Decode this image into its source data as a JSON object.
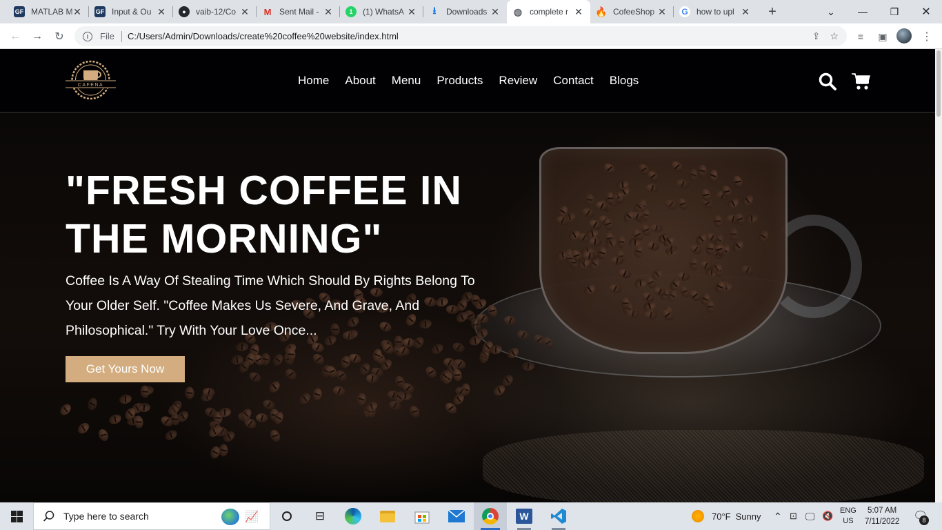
{
  "browser": {
    "tabs": [
      {
        "title": "MATLAB M",
        "favicon": "gfg"
      },
      {
        "title": "Input & Ou",
        "favicon": "gfg"
      },
      {
        "title": "vaib-12/Co",
        "favicon": "github"
      },
      {
        "title": "Sent Mail -",
        "favicon": "gmail"
      },
      {
        "title": "(1) WhatsA",
        "favicon": "whatsapp"
      },
      {
        "title": "Downloads",
        "favicon": "download"
      },
      {
        "title": "complete r",
        "favicon": "globe"
      },
      {
        "title": "CofeeShop",
        "favicon": "firebase"
      },
      {
        "title": "how to upl",
        "favicon": "google"
      }
    ],
    "active_tab": 6,
    "address": {
      "scheme": "File",
      "url": "C:/Users/Admin/Downloads/create%20coffee%20website/index.html"
    }
  },
  "site": {
    "logo_text": "CAFENA",
    "nav": [
      "Home",
      "About",
      "Menu",
      "Products",
      "Review",
      "Contact",
      "Blogs"
    ],
    "hero": {
      "title": "\"FRESH COFFEE IN THE MORNING\"",
      "text": "Coffee Is A Way Of Stealing Time Which Should By Rights Belong To Your Older Self. \"Coffee Makes Us Severe, And Grave, And Philosophical.\" Try With Your Love Once...",
      "button": "Get Yours Now"
    },
    "colors": {
      "accent": "#d3ad7f",
      "header_bg": "#010103"
    }
  },
  "taskbar": {
    "search_placeholder": "Type here to search",
    "weather": {
      "temp": "70°F",
      "condition": "Sunny"
    },
    "lang": {
      "top": "ENG",
      "bottom": "US"
    },
    "clock": {
      "time": "5:07 AM",
      "date": "7/11/2022"
    },
    "notifications": "8"
  }
}
